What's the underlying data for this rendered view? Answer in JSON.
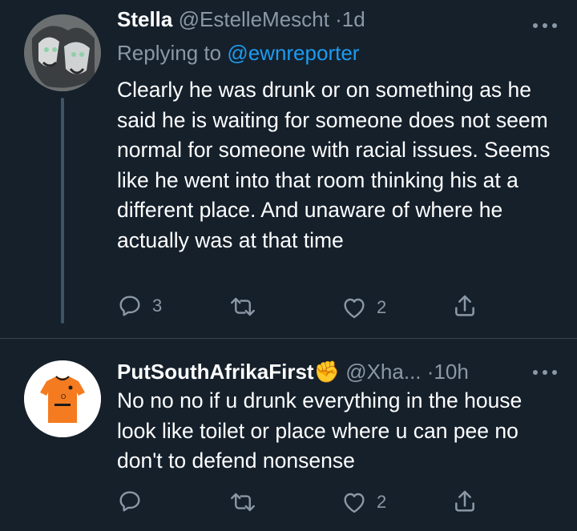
{
  "tweets": [
    {
      "display_name": "Stella",
      "handle": "@EstelleMescht",
      "dot": "·",
      "time": "1d",
      "replying_prefix": "Replying to",
      "replying_to": "@ewnreporter",
      "text": "Clearly he was drunk or on something as he said he is waiting for someone does not seem normal for someone with racial issues. Seems like he went into that room thinking his at a different place. And unaware of where he actually was at that time",
      "reply_count": "3",
      "retweet_count": "",
      "like_count": "2"
    },
    {
      "display_name": "PutSouthAfrikaFirst",
      "emoji": "✊",
      "handle": "@Xha...",
      "dot": "·",
      "time": "10h",
      "text": "No no no if u drunk everything in the house look like toilet or place where u can pee no don't to defend nonsense",
      "reply_count": "",
      "retweet_count": "",
      "like_count": "2"
    }
  ],
  "colors": {
    "background": "#15202b",
    "muted": "#8b98a5",
    "link": "#1d9bf0",
    "thread_line": "#3d5466",
    "jersey": "#f47b20"
  },
  "icons": [
    "more-icon",
    "reply-icon",
    "retweet-icon",
    "like-icon",
    "share-icon",
    "raised-fist-emoji"
  ]
}
